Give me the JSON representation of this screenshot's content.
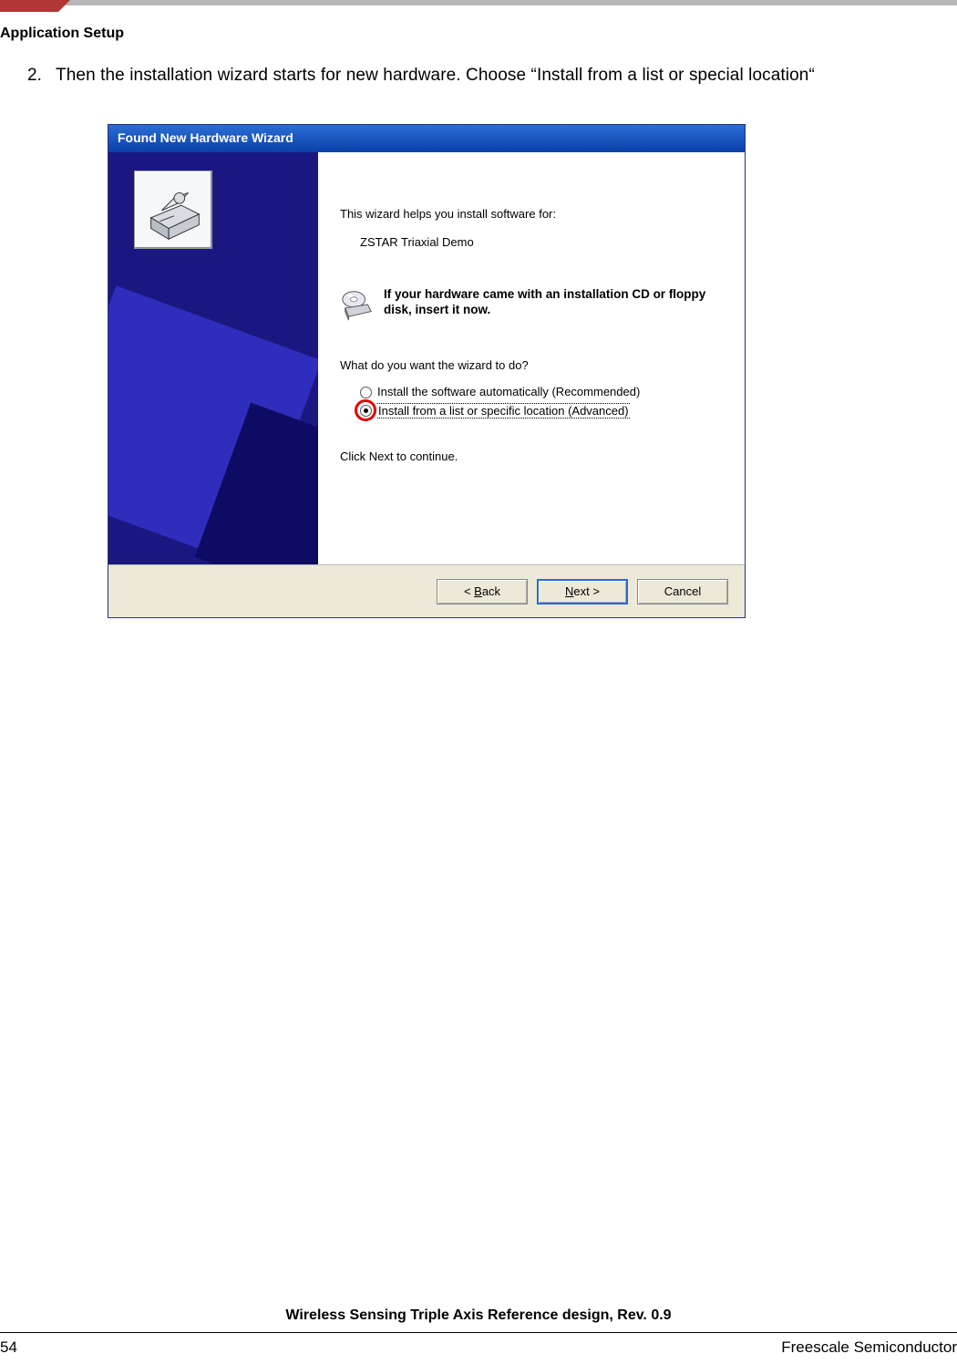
{
  "header": {
    "section": "Application Setup"
  },
  "instruction": {
    "number": "2.",
    "text": "Then the installation wizard starts for new hardware. Choose “Install from a list or special location“"
  },
  "dialog": {
    "title": "Found New Hardware Wizard",
    "intro": "This wizard helps you install software for:",
    "device": "ZSTAR Triaxial Demo",
    "cd_notice": "If your hardware came with an installation CD or floppy disk, insert it now.",
    "question": "What do you want the wizard to do?",
    "options": {
      "auto": "Install the software automatically (Recommended)",
      "list": "Install from a list or specific location (Advanced)"
    },
    "continue_hint": "Click Next to continue.",
    "buttons": {
      "back_pre": "< ",
      "back_u": "B",
      "back_post": "ack",
      "next_u": "N",
      "next_post": "ext >",
      "cancel": "Cancel"
    }
  },
  "footer": {
    "doc_title": "Wireless Sensing Triple Axis Reference design, Rev. 0.9",
    "page": "54",
    "brand": "Freescale Semiconductor"
  }
}
